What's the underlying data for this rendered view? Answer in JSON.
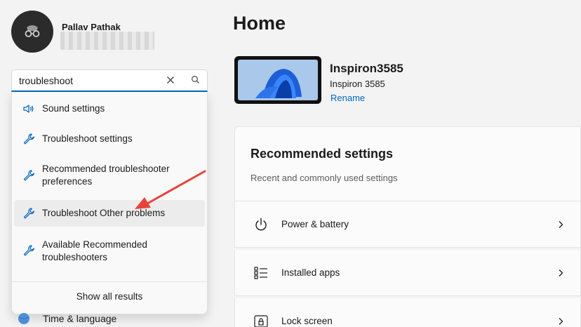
{
  "user": {
    "name": "Pallav Pathak"
  },
  "search": {
    "value": "troubleshoot",
    "results": [
      {
        "label": "Sound settings",
        "icon": "speaker-icon"
      },
      {
        "label": "Troubleshoot settings",
        "icon": "wrench-icon"
      },
      {
        "label": "Recommended troubleshooter preferences",
        "icon": "wrench-icon"
      },
      {
        "label": "Troubleshoot Other problems",
        "icon": "wrench-icon"
      },
      {
        "label": "Available Recommended troubleshooters",
        "icon": "wrench-icon"
      }
    ],
    "show_all_label": "Show all results"
  },
  "nav": {
    "time_language_label": "Time & language"
  },
  "main": {
    "title": "Home",
    "device": {
      "name": "Inspiron3585",
      "model": "Inspiron 3585",
      "rename_label": "Rename"
    },
    "recommended": {
      "title": "Recommended settings",
      "subtitle": "Recent and commonly used settings",
      "items": [
        {
          "label": "Power & battery",
          "icon": "power-icon"
        },
        {
          "label": "Installed apps",
          "icon": "apps-list-icon"
        },
        {
          "label": "Lock screen",
          "icon": "lock-screen-icon"
        }
      ]
    }
  },
  "colors": {
    "accent": "#0067c0",
    "annotation_arrow": "#e8433a"
  }
}
